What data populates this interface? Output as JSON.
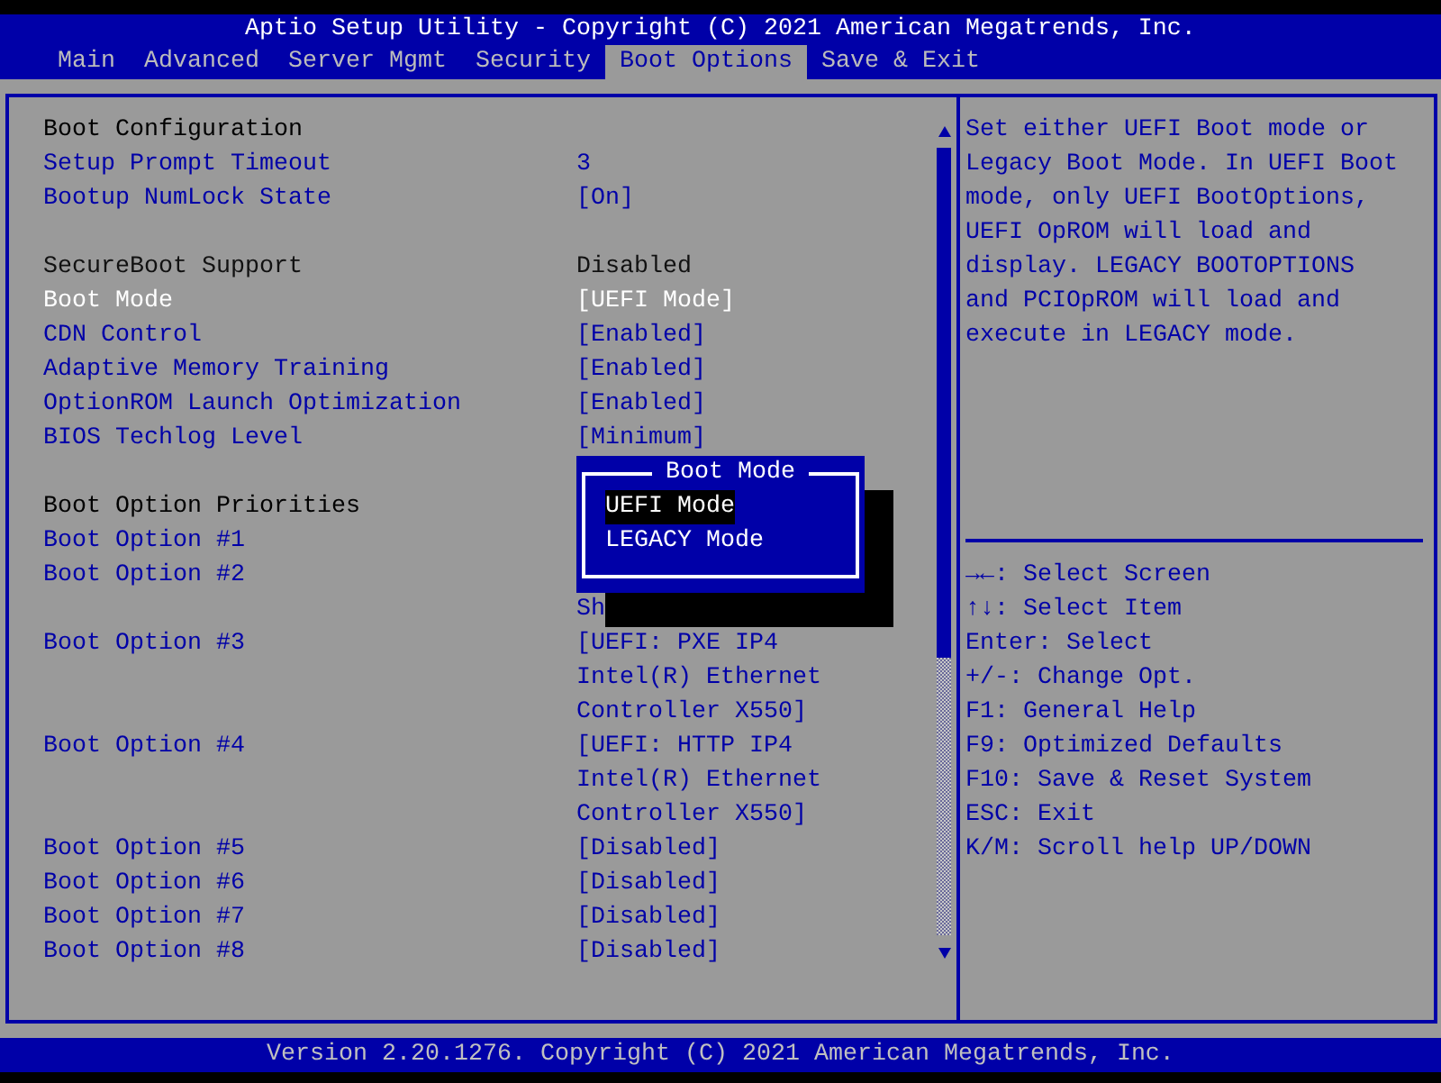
{
  "window": {
    "title": "Aptio Setup Utility - Copyright (C) 2021 American Megatrends, Inc."
  },
  "tabs": [
    {
      "label": "Main",
      "selected": false
    },
    {
      "label": "Advanced",
      "selected": false
    },
    {
      "label": "Server Mgmt",
      "selected": false
    },
    {
      "label": "Security",
      "selected": false
    },
    {
      "label": "Boot Options",
      "selected": true
    },
    {
      "label": "Save & Exit",
      "selected": false
    }
  ],
  "settings_groups": [
    {
      "title": "Boot Configuration",
      "items": [
        {
          "kind": "setting",
          "label": "Setup Prompt Timeout",
          "value": [
            "3"
          ],
          "selected": false
        },
        {
          "kind": "setting",
          "label": "Bootup NumLock State",
          "value": [
            "[On]"
          ],
          "selected": false
        }
      ]
    },
    {
      "items": [
        {
          "kind": "info",
          "label": "SecureBoot Support",
          "value": [
            "Disabled"
          ],
          "selected": false
        },
        {
          "kind": "setting",
          "label": "Boot Mode",
          "value": [
            "[UEFI Mode]"
          ],
          "selected": true
        },
        {
          "kind": "setting",
          "label": "CDN Control",
          "value": [
            "[Enabled]"
          ],
          "selected": false
        },
        {
          "kind": "setting",
          "label": "Adaptive Memory Training",
          "value": [
            "[Enabled]"
          ],
          "selected": false
        },
        {
          "kind": "setting",
          "label": "OptionROM Launch Optimization",
          "value": [
            "[Enabled]"
          ],
          "selected": false
        },
        {
          "kind": "setting",
          "label": "BIOS Techlog Level",
          "value": [
            "[Minimum]"
          ],
          "selected": false
        }
      ]
    },
    {
      "title": "Boot Option Priorities",
      "items": [
        {
          "kind": "setting",
          "label": "Boot Option #1",
          "selected": false
        },
        {
          "kind": "setting",
          "label": "Boot Option #2",
          "selected": false
        },
        {
          "kind": "continuation",
          "value": [
            "Sh"
          ],
          "selected": false
        },
        {
          "kind": "setting",
          "label": "Boot Option #3",
          "value": [
            "[UEFI: PXE IP4",
            "Intel(R) Ethernet",
            "Controller X550]"
          ],
          "selected": false
        },
        {
          "kind": "setting",
          "label": "Boot Option #4",
          "value": [
            "[UEFI: HTTP IP4",
            "Intel(R) Ethernet",
            "Controller X550]"
          ],
          "selected": false
        },
        {
          "kind": "setting",
          "label": "Boot Option #5",
          "value": [
            "[Disabled]"
          ],
          "selected": false
        },
        {
          "kind": "setting",
          "label": "Boot Option #6",
          "value": [
            "[Disabled]"
          ],
          "selected": false
        },
        {
          "kind": "setting",
          "label": "Boot Option #7",
          "value": [
            "[Disabled]"
          ],
          "selected": false
        },
        {
          "kind": "setting",
          "label": "Boot Option #8",
          "value": [
            "[Disabled]"
          ],
          "selected": false
        }
      ]
    }
  ],
  "popup": {
    "title": "Boot Mode",
    "options": [
      {
        "label": "UEFI Mode",
        "selected": true
      },
      {
        "label": "LEGACY Mode",
        "selected": false
      }
    ]
  },
  "help_text": "Set either UEFI Boot mode or Legacy Boot Mode. In UEFI Boot mode, only UEFI BootOptions, UEFI OpROM will load and display. LEGACY BOOTOPTIONS and PCIOpROM will load and execute in LEGACY mode.",
  "key_help": [
    "→←: Select Screen",
    "↑↓: Select Item",
    "Enter: Select",
    "+/-: Change Opt.",
    "F1: General Help",
    "F9: Optimized Defaults",
    "F10: Save & Reset System",
    "ESC: Exit",
    "K/M: Scroll help UP/DOWN"
  ],
  "status_bar": "Version 2.20.1276. Copyright (C) 2021 American Megatrends, Inc."
}
